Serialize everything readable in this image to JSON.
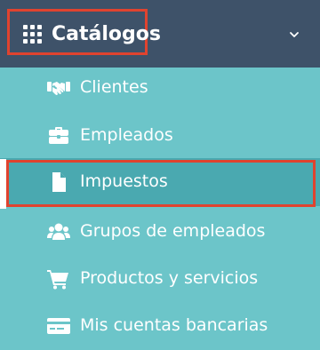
{
  "header": {
    "title": "Catálogos",
    "icon": "grid-icon",
    "expand_icon": "chevron-down-icon"
  },
  "menu": {
    "items": [
      {
        "label": "Clientes",
        "icon": "handshake-icon"
      },
      {
        "label": "Empleados",
        "icon": "briefcase-icon"
      },
      {
        "label": "Impuestos",
        "icon": "document-icon",
        "active": true
      },
      {
        "label": "Grupos de empleados",
        "icon": "users-icon"
      },
      {
        "label": "Productos y servicios",
        "icon": "shopping-cart-icon"
      },
      {
        "label": "Mis cuentas bancarias",
        "icon": "credit-card-icon"
      }
    ]
  },
  "colors": {
    "header_bg": "#3e5269",
    "menu_bg": "#6cc5c9",
    "active_bg": "#4aa9b0",
    "highlight_border": "#e0432f",
    "text": "#ffffff"
  }
}
